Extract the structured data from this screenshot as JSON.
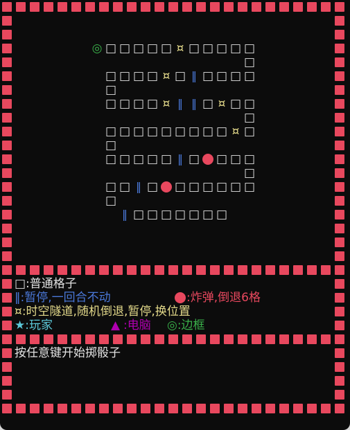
{
  "board": {
    "start_symbol": "◎",
    "square": "□",
    "tunnel": "¤",
    "pause": "‖",
    "bomb": "●",
    "rows": [
      "◎□□□□□¤□□□□□",
      "           □",
      " □□□□¤□‖□□□□",
      " □",
      " □□□□¤‖‖□¤□□",
      "           □",
      " □□□□□□□□□¤□",
      " □",
      " □□□□□‖□●□□□",
      "           □",
      " □□‖□●□□□□□□",
      " □",
      "  ‖□□□□□□□"
    ]
  },
  "legend": {
    "normal": "□:普通格子",
    "pause": "‖:暂停,一回合不动",
    "bomb_symbol": "●",
    "bomb": ":炸弹,倒退6格",
    "tunnel": "¤:时空隧道,随机倒退,暂停,换位置",
    "player": "★:玩家",
    "computer_symbol": "▲",
    "computer": ":电脑",
    "border": "◎:边框"
  },
  "prompt": "按任意键开始掷骰子",
  "colors": {
    "frame": "#e8485e",
    "background": "#0c0c0c",
    "normal": "#e2e2e2",
    "pause": "#4a78d8",
    "tunnel": "#e3d98a",
    "player": "#5cc8d8",
    "computer": "#b000b0",
    "border": "#3ab04a"
  }
}
